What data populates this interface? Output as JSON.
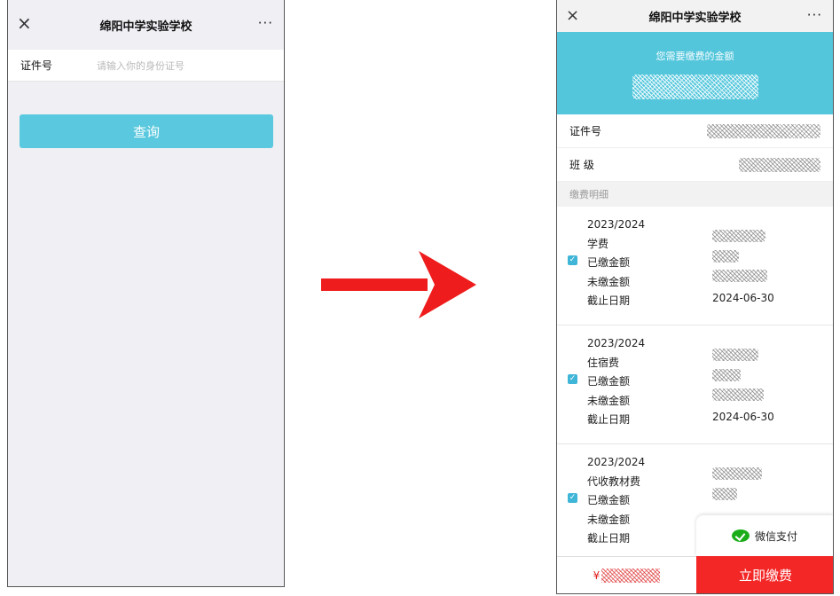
{
  "left": {
    "nav": {
      "close_icon": "×",
      "title": "绵阳中学实验学校",
      "more": "···"
    },
    "form": {
      "id_label": "证件号",
      "id_placeholder": "请输入你的身份证号"
    },
    "query_button": "查询"
  },
  "right": {
    "nav": {
      "close_icon": "×",
      "title": "绵阳中学实验学校",
      "more": "···"
    },
    "banner": {
      "text": "您需要缴费的金额"
    },
    "info": {
      "id_label": "证件号",
      "class_label": "班 级"
    },
    "section_title": "缴费明细",
    "items": [
      {
        "year": "2023/2024",
        "name": "学费",
        "paid_label": "已缴金额",
        "unpaid_label": "未缴金额",
        "deadline_label": "截止日期",
        "deadline": "2024-06-30",
        "checked": true
      },
      {
        "year": "2023/2024",
        "name": "住宿费",
        "paid_label": "已缴金额",
        "unpaid_label": "未缴金额",
        "deadline_label": "截止日期",
        "deadline": "2024-06-30",
        "checked": true
      },
      {
        "year": "2023/2024",
        "name": "代收教材费",
        "paid_label": "已缴金额",
        "unpaid_label": "未缴金额",
        "deadline_label": "截止日期",
        "deadline": "",
        "checked": true
      }
    ],
    "wechat_pay": "微信支付",
    "currency": "¥",
    "pay_button": "立即缴费"
  },
  "colors": {
    "accent": "#53c6dc",
    "pay_red": "#f42727",
    "wechat_green": "#1aad19",
    "checkbox": "#3fb5d7"
  }
}
